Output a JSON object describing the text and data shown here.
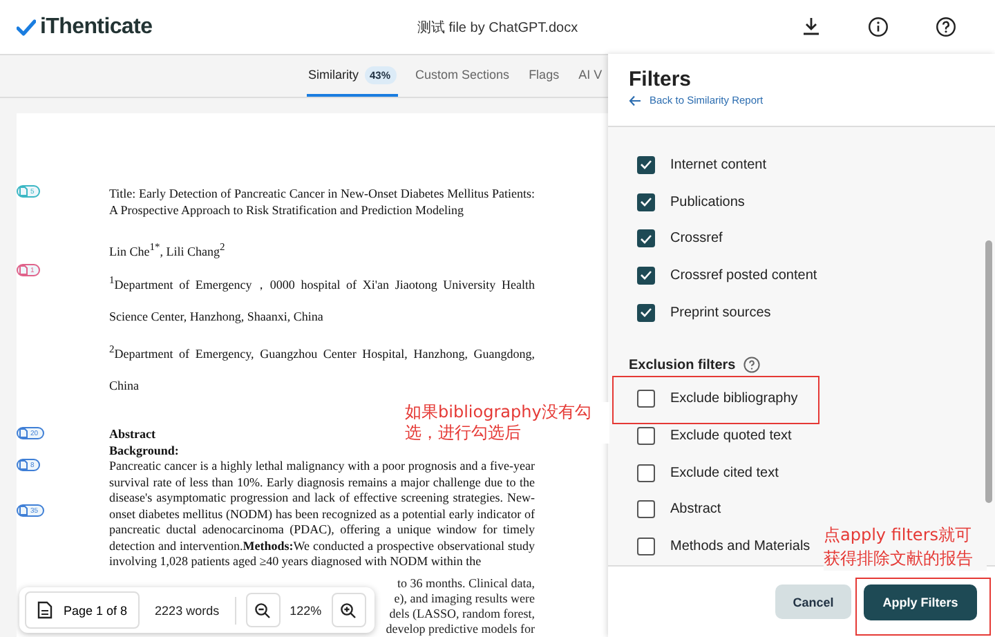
{
  "header": {
    "brand": "iThenticate",
    "file_title": "测试 file by ChatGPT.docx"
  },
  "tabs": [
    {
      "label": "Similarity",
      "badge": "43%",
      "selected": true
    },
    {
      "label": "Custom Sections",
      "selected": false
    },
    {
      "label": "Flags",
      "selected": false
    },
    {
      "label": "AI V",
      "selected": false
    }
  ],
  "document": {
    "blocks": [
      {
        "kind": "title",
        "text": "Title: Early Detection of Pancreatic Cancer in New-Onset Diabetes Mellitus Patients: A Prospective Approach to Risk Stratification and Prediction Modeling",
        "markers": [
          {
            "count": "5",
            "color": "#3bb7c4"
          }
        ]
      },
      {
        "kind": "plain",
        "text": "Lin Che$^{1*}$, Lili Chang$^{2}$"
      },
      {
        "kind": "spaced",
        "text": "$^{1}$Department of Emergency，0000 hospital of  Xi'an Jiaotong University Health Science Center, Hanzhong, Shaanxi, China",
        "markers": [
          {
            "count": "1",
            "color": "#e0628a"
          }
        ]
      },
      {
        "kind": "spaced",
        "text": "$^{2}$Department of Emergency, Guangzhou Center Hospital, Hanzhong, Guangdong, China"
      },
      {
        "kind": "heading",
        "text": "Abstract",
        "markers": [
          {
            "count": "20",
            "color": "#3f7fd6"
          }
        ]
      },
      {
        "kind": "heading",
        "text": "Background:"
      },
      {
        "kind": "paragraph",
        "text": "Pancreatic cancer is a highly lethal malignancy with a poor prognosis and a five-year survival rate of less than 10%. Early diagnosis remains a major challenge due to the disease's asymptomatic progression and lack of effective screening strategies. New-onset diabetes mellitus (NODM) has been recognized as a potential early indicator of pancreatic ductal adenocarcinoma (PDAC), offering a unique window for timely detection and intervention.**Methods:**We conducted a prospective observational study involving 1,028 patients aged ≥40 years diagnosed with NODM within the",
        "markers": [
          {
            "count": "8",
            "color": "#3f7fd6"
          },
          {
            "count": "35",
            "color": "#3f7fd6"
          }
        ]
      }
    ],
    "hidden_fragments": [
      "to 36 months. Clinical data,",
      "e), and imaging results were",
      "dels (LASSO, random forest,",
      "develop predictive models for"
    ]
  },
  "toolbar": {
    "page": "Page 1 of 8",
    "words": "2223 words",
    "zoom": "122%"
  },
  "panel": {
    "title": "Filters",
    "back_link": "Back to Similarity Report",
    "source_items": [
      {
        "label": "Internet content",
        "checked": true
      },
      {
        "label": "Publications",
        "checked": true
      },
      {
        "label": "Crossref",
        "checked": true
      },
      {
        "label": "Crossref posted content",
        "checked": true
      },
      {
        "label": "Preprint sources",
        "checked": true
      }
    ],
    "exclusion_heading": "Exclusion filters",
    "exclusion_items": [
      {
        "label": "Exclude bibliography",
        "checked": false
      },
      {
        "label": "Exclude quoted text",
        "checked": false
      },
      {
        "label": "Exclude cited text",
        "checked": false
      },
      {
        "label": "Abstract",
        "checked": false
      },
      {
        "label": "Methods and Materials",
        "checked": false
      }
    ],
    "buttons": {
      "cancel": "Cancel",
      "apply": "Apply Filters"
    }
  },
  "annotations": [
    "如果bibliography没有勾选，进行勾选后",
    "点apply filters就可获得排除文献的报告"
  ]
}
